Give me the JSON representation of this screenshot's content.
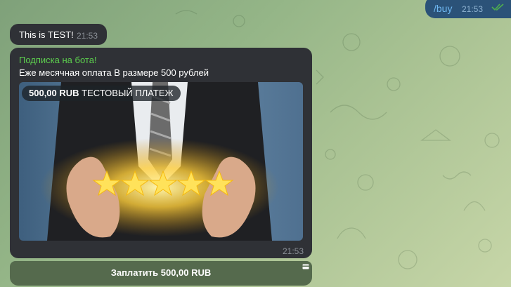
{
  "outgoing": {
    "text": "/buy",
    "time": "21:53",
    "status_icon": "double-check-icon"
  },
  "test_message": {
    "text": "This is TEST!",
    "time": "21:53"
  },
  "invoice": {
    "title": "Подписка на бота!",
    "description": "Еже месячная оплата В размере 500 рублей",
    "badge_amount": "500,00 RUB",
    "badge_label": "ТЕСТОВЫЙ ПЛАТЕЖ",
    "time": "21:53",
    "image_icon": "businessman-five-stars-photo"
  },
  "pay_button": {
    "label": "Заплатить 500,00 RUB",
    "icon": "card-icon"
  },
  "colors": {
    "bubble": "#2f3136",
    "outgoing_bubble": "#2b5278",
    "title_green": "#5dd04e",
    "pay_button": "#556a4d",
    "link_blue": "#6fb8f2"
  }
}
